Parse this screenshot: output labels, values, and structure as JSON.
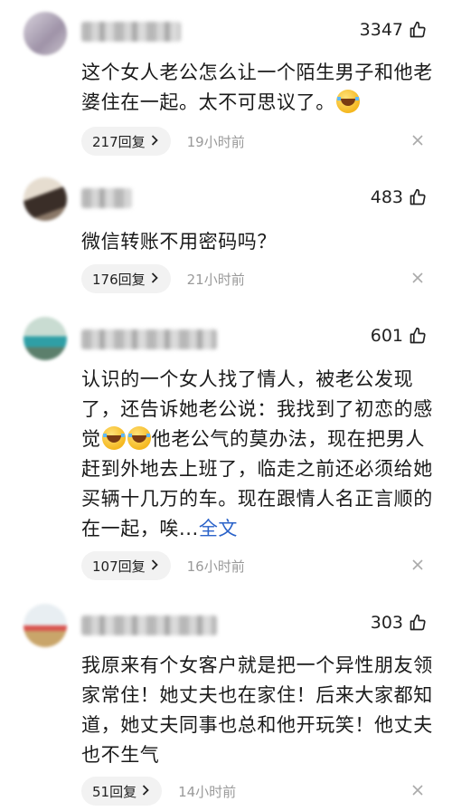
{
  "comments": [
    {
      "likes": "3347",
      "lines": [
        "这个女人老公怎么让一个陌生男子和他",
        "老婆住在一起。太不可思议了。"
      ],
      "replies": "217回复",
      "time": "19小时前"
    },
    {
      "likes": "483",
      "lines": [
        "微信转账不用密码吗？"
      ],
      "replies": "176回复",
      "time": "21小时前"
    },
    {
      "likes": "601",
      "lines": [
        "认识的一个女人找了情人，被老公发现",
        "了，还告诉她老公说：我找到了初恋的",
        "感觉",
        "他老公气的莫办法，现在把",
        "男人赶到外地去上班了，临走之前还必",
        "须给她买辆十几万的车。现在跟情人名",
        "正言顺的在一起，唉..."
      ],
      "full_text_link": "全文",
      "replies": "107回复",
      "time": "16小时前"
    },
    {
      "likes": "303",
      "lines": [
        "我原来有个女客户就是把一个异性朋友",
        "领家常住！她丈夫也在家住！后来大家",
        "都知道，她丈夫同事也总和他开玩笑！",
        "他丈夫也不生气"
      ],
      "replies": "51回复",
      "time": "14小时前"
    }
  ],
  "icons": {
    "like": "thumbs-up-icon",
    "reply_arrow": "chevron-right-icon",
    "close": "close-icon",
    "emoji": "laughing-crying-emoji"
  },
  "colors": {
    "link": "#2a62c9",
    "meta": "#9a9a9a",
    "pill": "#f2f2f2"
  }
}
